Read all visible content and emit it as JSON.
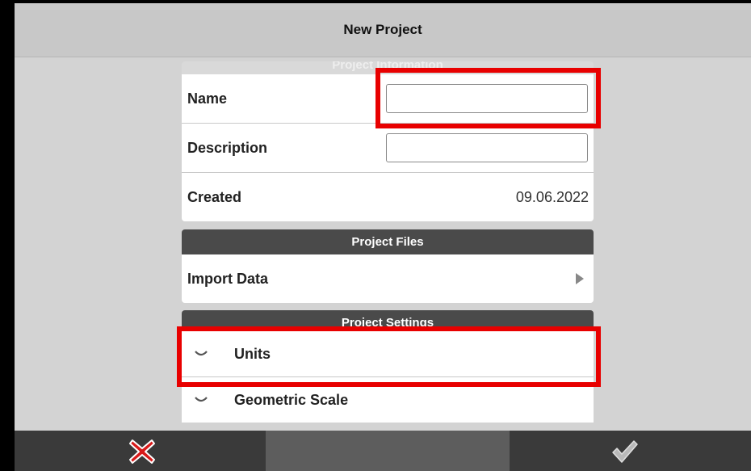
{
  "header": {
    "title": "New Project"
  },
  "project_information": {
    "section_title": "Project Information",
    "name_label": "Name",
    "name_value": "",
    "description_label": "Description",
    "description_value": "",
    "created_label": "Created",
    "created_value": "09.06.2022"
  },
  "project_files": {
    "section_title": "Project Files",
    "import_label": "Import Data"
  },
  "project_settings": {
    "section_title": "Project Settings",
    "units_label": "Units",
    "geometric_scale_label": "Geometric Scale"
  },
  "footer": {
    "cancel_icon": "red-x-icon",
    "confirm_icon": "checkmark-icon"
  },
  "colors": {
    "highlight": "#e80000",
    "section_header": "#4a4a4a",
    "footer": "#3a3a3a"
  }
}
